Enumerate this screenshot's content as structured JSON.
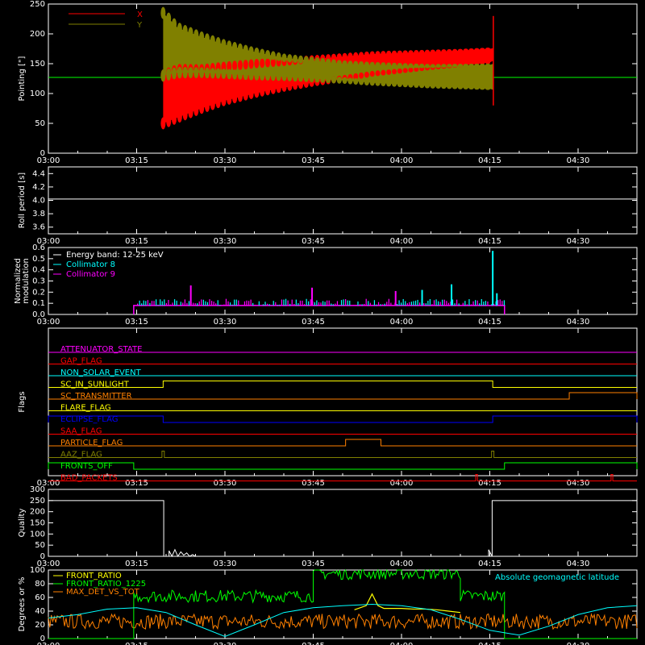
{
  "chart_data": [
    {
      "id": "pointing",
      "type": "area",
      "ylabel": "Pointing [\"]",
      "xlim": [
        0,
        100
      ],
      "ylim": [
        0,
        250
      ],
      "yticks": [
        0,
        50,
        100,
        150,
        200,
        250
      ],
      "x_tick_labels": [
        "03:00",
        "03:15",
        "03:30",
        "03:45",
        "04:00",
        "04:15",
        "04:30"
      ],
      "x_tick_minutes": [
        0,
        15,
        30,
        45,
        60,
        75,
        90
      ],
      "reference_y": 127,
      "legend": [
        {
          "name": "X",
          "color": "#ff0000"
        },
        {
          "name": "Y",
          "color": "#808000"
        }
      ],
      "series": [
        {
          "name": "X",
          "color": "#ff0000",
          "x": [
            19.5,
            22,
            26,
            30,
            35,
            40,
            45,
            50,
            55,
            60,
            65,
            70,
            75,
            75.6
          ],
          "upper": [
            130,
            140,
            140,
            145,
            150,
            153,
            158,
            162,
            166,
            168,
            170,
            172,
            175,
            176
          ],
          "lower": [
            50,
            60,
            75,
            88,
            100,
            110,
            118,
            125,
            133,
            138,
            143,
            147,
            152,
            155
          ]
        },
        {
          "name": "Y",
          "color": "#808000",
          "x": [
            19.5,
            22,
            26,
            30,
            35,
            40,
            45,
            50,
            55,
            60,
            65,
            70,
            75,
            75.6
          ],
          "upper": [
            235,
            210,
            195,
            182,
            170,
            160,
            155,
            150,
            148,
            147,
            146,
            147,
            148,
            150
          ],
          "lower": [
            130,
            135,
            135,
            133,
            130,
            128,
            125,
            122,
            118,
            115,
            112,
            110,
            108,
            106
          ]
        }
      ]
    },
    {
      "id": "roll-period",
      "type": "line",
      "ylabel": "Roll period [s]",
      "ylim": [
        3.5,
        4.5
      ],
      "yticks": [
        3.6,
        3.8,
        4.0,
        4.2,
        4.4
      ],
      "x_tick_labels": [
        "03:00",
        "03:15",
        "03:30",
        "03:45",
        "04:00",
        "04:15",
        "04:30"
      ],
      "x_tick_minutes": [
        0,
        15,
        30,
        45,
        60,
        75,
        90
      ],
      "series": [
        {
          "name": "",
          "color": "#ffffff",
          "x": [
            0,
            100
          ],
          "y": [
            4.02,
            4.02
          ]
        }
      ]
    },
    {
      "id": "modulation",
      "type": "bar",
      "ylabel": "Normalized modulation",
      "ylim": [
        0,
        0.6
      ],
      "yticks": [
        0.0,
        0.1,
        0.2,
        0.3,
        0.4,
        0.5,
        0.6
      ],
      "x_tick_labels": [
        "03:00",
        "03:15",
        "03:30",
        "03:45",
        "04:00",
        "04:15",
        "04:30"
      ],
      "x_tick_minutes": [
        0,
        15,
        30,
        45,
        60,
        75,
        90
      ],
      "data_range_minutes": [
        14.5,
        77.5
      ],
      "legend": [
        {
          "name": "Energy band: 12-25 keV",
          "color": "#ffffff"
        },
        {
          "name": "Collimator 8",
          "color": "#00ffff"
        },
        {
          "name": "Collimator 9",
          "color": "#ff00ff"
        }
      ],
      "baseline": 0.08,
      "peaks": [
        {
          "x": 75.5,
          "y": 0.57,
          "color": "#00ffff"
        },
        {
          "x": 68.5,
          "y": 0.27,
          "color": "#00ffff"
        },
        {
          "x": 63.5,
          "y": 0.22,
          "color": "#00ffff"
        },
        {
          "x": 76.2,
          "y": 0.19,
          "color": "#00ffff"
        },
        {
          "x": 24.2,
          "y": 0.26,
          "color": "#ff00ff"
        },
        {
          "x": 44.8,
          "y": 0.24,
          "color": "#ff00ff"
        },
        {
          "x": 59.0,
          "y": 0.21,
          "color": "#ff00ff"
        }
      ]
    },
    {
      "id": "flags",
      "type": "line",
      "ylabel": "Flags",
      "x_tick_labels": [
        "03:00",
        "03:15",
        "03:30",
        "03:45",
        "04:00",
        "04:15",
        "04:30"
      ],
      "x_tick_minutes": [
        0,
        15,
        30,
        45,
        60,
        75,
        90
      ],
      "flags": [
        {
          "name": "ATTENUATOR_STATE",
          "color": "#ff00ff",
          "highs": []
        },
        {
          "name": "GAP_FLAG",
          "color": "#ff0000",
          "highs": []
        },
        {
          "name": "NON_SOLAR_EVENT",
          "color": "#00ffff",
          "highs": []
        },
        {
          "name": "SC_IN_SUNLIGHT",
          "color": "#ffff00",
          "highs": [
            [
              19.5,
              75.5
            ]
          ]
        },
        {
          "name": "SC_TRANSMITTER",
          "color": "#ff8000",
          "highs": [
            [
              88.5,
              100
            ]
          ]
        },
        {
          "name": "FLARE_FLAG",
          "color": "#ffff00",
          "highs": []
        },
        {
          "name": "ECLIPSE_FLAG",
          "color": "#0000ff",
          "highs": [
            [
              0,
              19.5
            ],
            [
              75.5,
              100
            ]
          ]
        },
        {
          "name": "SAA_FLAG",
          "color": "#ff0000",
          "highs": []
        },
        {
          "name": "PARTICLE_FLAG",
          "color": "#ff8000",
          "highs": [
            [
              50.5,
              56.5
            ]
          ]
        },
        {
          "name": "AAZ_FLAG",
          "color": "#808000",
          "highs": [
            [
              19.3,
              19.7
            ],
            [
              75.3,
              75.7
            ]
          ]
        },
        {
          "name": "FRONTS_OFF",
          "color": "#00ff00",
          "highs": [
            [
              0,
              14.5
            ],
            [
              77.5,
              100
            ]
          ]
        },
        {
          "name": "BAD_PACKETS",
          "color": "#ff0000",
          "highs": [
            [
              72.6,
              72.9
            ],
            [
              95.6,
              95.9
            ]
          ]
        }
      ]
    },
    {
      "id": "quality",
      "type": "line",
      "ylabel": "Quality",
      "ylim": [
        0,
        300
      ],
      "yticks": [
        0,
        50,
        100,
        150,
        200,
        250,
        300
      ],
      "x_tick_labels": [
        "03:00",
        "03:15",
        "03:30",
        "03:45",
        "04:00",
        "04:15",
        "04:30"
      ],
      "x_tick_minutes": [
        0,
        15,
        30,
        45,
        60,
        75,
        90
      ],
      "series": [
        {
          "name": "",
          "color": "#ffffff",
          "x": [
            0,
            19.6,
            19.6,
            20.5,
            20.5,
            21,
            21.5,
            22,
            22.5,
            23,
            23.5,
            24,
            24.5,
            25,
            74.8,
            74.8,
            75.4,
            75.4,
            100
          ],
          "y": [
            250,
            250,
            0,
            0,
            25,
            0,
            30,
            0,
            20,
            5,
            15,
            0,
            8,
            0,
            0,
            30,
            0,
            250,
            250
          ]
        }
      ]
    },
    {
      "id": "ratios",
      "type": "line",
      "ylabel": "Degrees or %",
      "ylim": [
        0,
        100
      ],
      "yticks": [
        0,
        20,
        40,
        60,
        80,
        100
      ],
      "x_tick_labels": [
        "03:00",
        "03:15",
        "03:30",
        "03:45",
        "04:00",
        "04:15",
        "04:30"
      ],
      "x_tick_minutes": [
        0,
        15,
        30,
        45,
        60,
        75,
        90
      ],
      "legend": [
        {
          "name": "FRONT_RATIO",
          "color": "#ffff00"
        },
        {
          "name": "FRONT_RATIO_1225",
          "color": "#00ff00"
        },
        {
          "name": "MAX_DET_VS_TOT",
          "color": "#ff8000"
        }
      ],
      "annotation": {
        "text": "Absolute geomagnetic latitude",
        "color": "#00ffff"
      },
      "series": [
        {
          "name": "Absolute geomagnetic latitude",
          "color": "#00ffff",
          "x": [
            0,
            5,
            10,
            15,
            20,
            25,
            30,
            35,
            40,
            45,
            50,
            55,
            60,
            65,
            70,
            75,
            80,
            85,
            90,
            95,
            100
          ],
          "y": [
            30,
            35,
            43,
            45,
            38,
            20,
            3,
            20,
            38,
            45,
            48,
            50,
            48,
            42,
            28,
            12,
            5,
            18,
            35,
            45,
            48
          ]
        },
        {
          "name": "FRONT_RATIO",
          "color": "#ffff00",
          "x": [
            52,
            54,
            55,
            56,
            57,
            58,
            60,
            62,
            64,
            66,
            68,
            70
          ],
          "y": [
            42,
            48,
            65,
            48,
            44,
            44,
            44,
            43,
            43,
            42,
            40,
            38
          ]
        },
        {
          "name": "FRONT_RATIO_1225",
          "color": "#00ff00",
          "segments": [
            [
              14.5,
              45,
              62
            ],
            [
              45,
              70,
              95
            ],
            [
              70,
              77.5,
              62
            ]
          ]
        },
        {
          "name": "MAX_DET_VS_TOT",
          "color": "#ff8000",
          "mean": 25
        }
      ]
    }
  ]
}
